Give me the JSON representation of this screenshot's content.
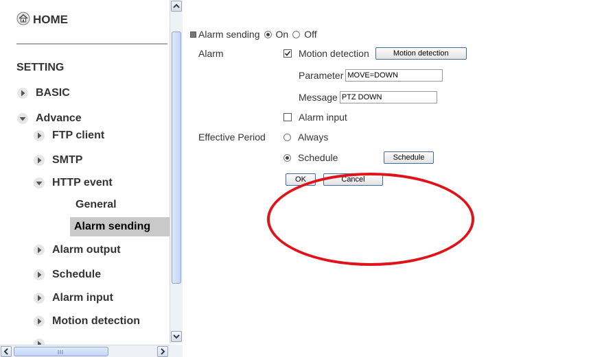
{
  "sidebar": {
    "home_label": "HOME",
    "setting_label": "SETTING",
    "items": {
      "basic": "BASIC",
      "advance": "Advance",
      "ftp_client": "FTP client",
      "smtp": "SMTP",
      "http_event": "HTTP event",
      "general": "General",
      "alarm_sending": "Alarm sending",
      "alarm_output": "Alarm output",
      "schedule": "Schedule",
      "alarm_input": "Alarm input",
      "motion_detection": "Motion detection"
    }
  },
  "form": {
    "alarm_sending_label": "Alarm sending",
    "on_label": "On",
    "off_label": "Off",
    "alarm_label": "Alarm",
    "motion_detection_label": "Motion detection",
    "motion_detection_button": "Motion detection",
    "parameter_label": "Parameter",
    "parameter_value": "MOVE=DOWN",
    "message_label": "Message",
    "message_value": "PTZ DOWN",
    "alarm_input_label": "Alarm input",
    "effective_period_label": "Effective Period",
    "always_label": "Always",
    "schedule_label": "Schedule",
    "schedule_button": "Schedule",
    "ok_button": "OK",
    "cancel_button": "Cancel"
  },
  "state": {
    "alarm_sending": "On",
    "motion_detection_checked": true,
    "alarm_input_checked": false,
    "effective_period": "Schedule"
  },
  "colors": {
    "annotation": "#e0131a",
    "button_border": "#3c6ca6",
    "active_nav_bg": "#c9c9c9"
  }
}
